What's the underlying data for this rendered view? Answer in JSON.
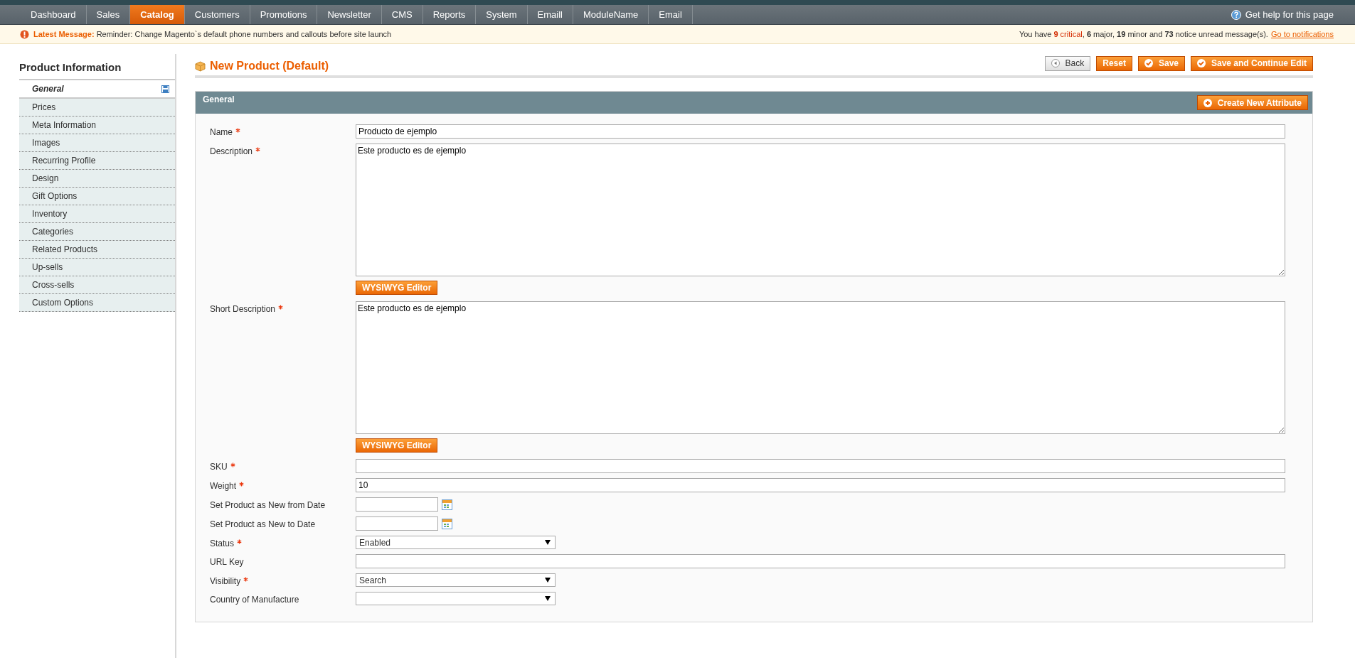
{
  "nav": {
    "items": [
      {
        "label": "Dashboard",
        "selected": false
      },
      {
        "label": "Sales",
        "selected": false
      },
      {
        "label": "Catalog",
        "selected": true
      },
      {
        "label": "Customers",
        "selected": false
      },
      {
        "label": "Promotions",
        "selected": false
      },
      {
        "label": "Newsletter",
        "selected": false
      },
      {
        "label": "CMS",
        "selected": false
      },
      {
        "label": "Reports",
        "selected": false
      },
      {
        "label": "System",
        "selected": false
      },
      {
        "label": "Emaill",
        "selected": false
      },
      {
        "label": "ModuleName",
        "selected": false
      },
      {
        "label": "Email",
        "selected": false
      }
    ],
    "help": "Get help for this page"
  },
  "message_bar": {
    "label": "Latest Message:",
    "text": "Reminder: Change Magento`s default phone numbers and callouts before site launch",
    "summary": [
      {
        "text": "You have ",
        "kind": "plain"
      },
      {
        "text": "9",
        "kind": "critical-count"
      },
      {
        "text": " critical",
        "kind": "critical"
      },
      {
        "text": ", ",
        "kind": "plain"
      },
      {
        "text": "6",
        "kind": "count"
      },
      {
        "text": " major, ",
        "kind": "plain"
      },
      {
        "text": "19",
        "kind": "count"
      },
      {
        "text": " minor and ",
        "kind": "plain"
      },
      {
        "text": "73",
        "kind": "count"
      },
      {
        "text": " notice unread message(s).",
        "kind": "plain"
      }
    ],
    "link": "Go to notifications"
  },
  "sidebar": {
    "title": "Product Information",
    "items": [
      {
        "label": "General",
        "selected": true
      },
      {
        "label": "Prices",
        "selected": false
      },
      {
        "label": "Meta Information",
        "selected": false
      },
      {
        "label": "Images",
        "selected": false
      },
      {
        "label": "Recurring Profile",
        "selected": false
      },
      {
        "label": "Design",
        "selected": false
      },
      {
        "label": "Gift Options",
        "selected": false
      },
      {
        "label": "Inventory",
        "selected": false
      },
      {
        "label": "Categories",
        "selected": false
      },
      {
        "label": "Related Products",
        "selected": false
      },
      {
        "label": "Up-sells",
        "selected": false
      },
      {
        "label": "Cross-sells",
        "selected": false
      },
      {
        "label": "Custom Options",
        "selected": false
      }
    ]
  },
  "page_title": "New Product (Default)",
  "buttons": [
    {
      "label": "Back",
      "kind": "back"
    },
    {
      "label": "Reset",
      "kind": "plain"
    },
    {
      "label": "Save",
      "kind": "check"
    },
    {
      "label": "Save and Continue Edit",
      "kind": "check"
    }
  ],
  "section": {
    "title": "General",
    "action": "Create New Attribute",
    "fields": [
      {
        "label": "Name",
        "required": true,
        "kind": "text",
        "value": "Producto de ejemplo"
      },
      {
        "label": "Description",
        "required": true,
        "kind": "textarea",
        "value": "Este producto es de ejemplo",
        "editor_button": "WYSIWYG Editor"
      },
      {
        "label": "Short Description",
        "required": true,
        "kind": "textarea",
        "value": "Este producto es de ejemplo",
        "editor_button": "WYSIWYG Editor"
      },
      {
        "label": "SKU",
        "required": true,
        "kind": "text"
      },
      {
        "label": "Weight",
        "required": true,
        "kind": "text",
        "value": "10"
      },
      {
        "label": "Set Product as New from Date",
        "required": false,
        "kind": "date"
      },
      {
        "label": "Set Product as New to Date",
        "required": false,
        "kind": "date"
      },
      {
        "label": "Status",
        "required": true,
        "kind": "select",
        "value": "Enabled"
      },
      {
        "label": "URL Key",
        "required": false,
        "kind": "text"
      },
      {
        "label": "Visibility",
        "required": true,
        "kind": "select",
        "value": "Search"
      },
      {
        "label": "Country of Manufacture",
        "required": false,
        "kind": "select"
      }
    ]
  }
}
